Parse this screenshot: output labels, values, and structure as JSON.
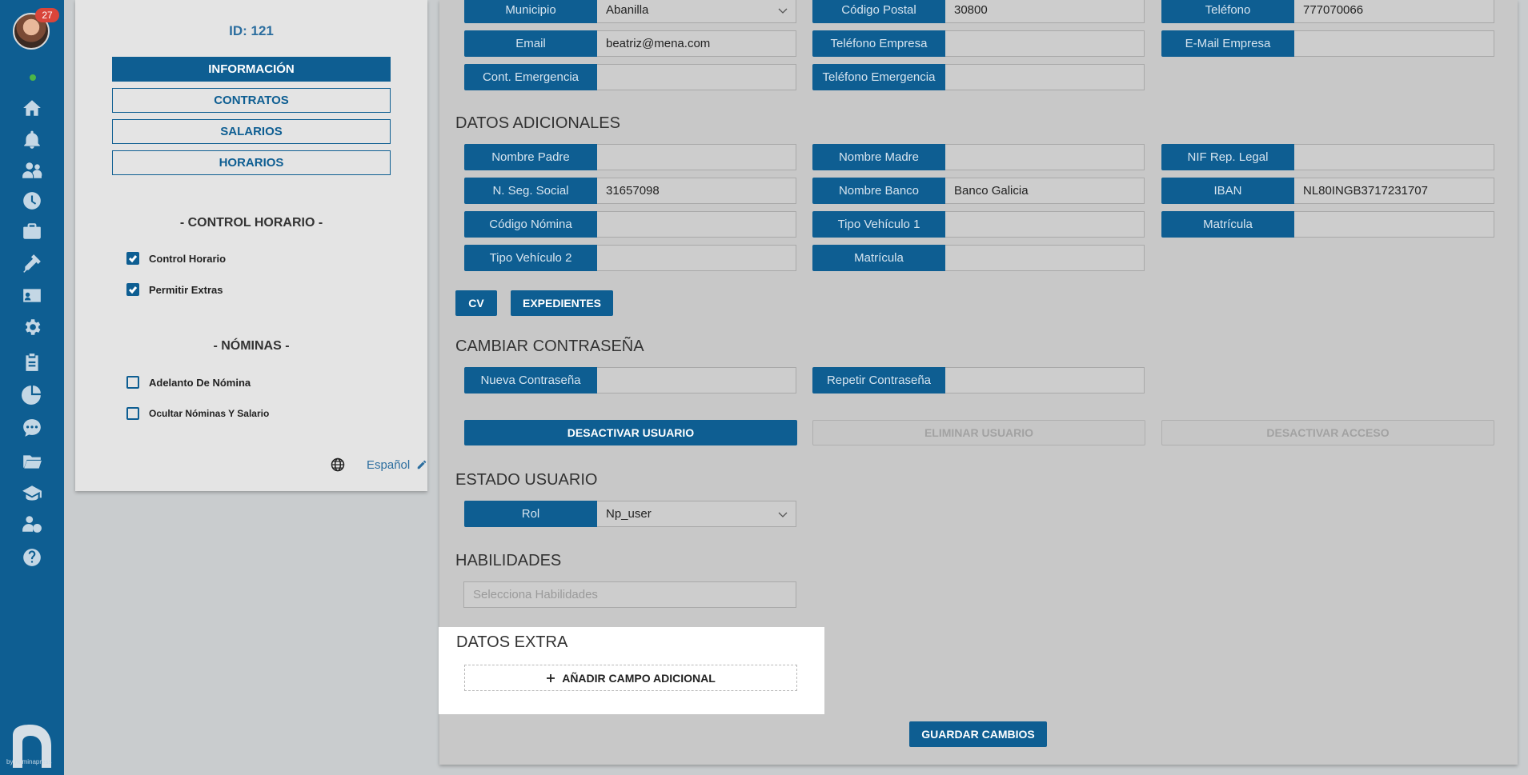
{
  "sidebar": {
    "badge": "27",
    "icons": [
      "home-icon",
      "bell-icon",
      "users-icon",
      "clock-icon",
      "briefcase-icon",
      "tools-icon",
      "id-card-icon",
      "gear-icon",
      "clipboard-icon",
      "pie-chart-icon",
      "chat-icon",
      "folder-icon",
      "graduation-cap-icon",
      "user-money-icon",
      "help-icon"
    ],
    "logo_by": "by nominapress"
  },
  "profile": {
    "id_label": "ID: 121",
    "nav": [
      "INFORMACIÓN",
      "CONTRATOS",
      "SALARIOS",
      "HORARIOS"
    ],
    "control_horario_title": "- CONTROL HORARIO -",
    "control_horario": [
      {
        "label": "Control Horario",
        "checked": true
      },
      {
        "label": "Permitir Extras",
        "checked": true
      }
    ],
    "nominas_title": "- NÓMINAS -",
    "nominas": [
      {
        "label": "Adelanto De Nómina",
        "checked": false
      },
      {
        "label": "Ocultar Nóminas Y Salario",
        "checked": false
      }
    ],
    "language": "Español"
  },
  "contact": {
    "municipio": {
      "label": "Municipio",
      "value": "Abanilla"
    },
    "codigo_postal": {
      "label": "Código Postal",
      "value": "30800"
    },
    "telefono": {
      "label": "Teléfono",
      "value": "777070066"
    },
    "email": {
      "label": "Email",
      "value": "beatriz@mena.com"
    },
    "telefono_empresa": {
      "label": "Teléfono Empresa",
      "value": ""
    },
    "email_empresa": {
      "label": "E-Mail Empresa",
      "value": ""
    },
    "cont_emergencia": {
      "label": "Cont. Emergencia",
      "value": ""
    },
    "telefono_emergencia": {
      "label": "Teléfono Emergencia",
      "value": ""
    }
  },
  "datos_adicionales": {
    "title": "DATOS ADICIONALES",
    "nombre_padre": {
      "label": "Nombre Padre",
      "value": ""
    },
    "nombre_madre": {
      "label": "Nombre Madre",
      "value": ""
    },
    "nif_rep_legal": {
      "label": "NIF Rep. Legal",
      "value": ""
    },
    "n_seg_social": {
      "label": "N. Seg. Social",
      "value": "31657098"
    },
    "nombre_banco": {
      "label": "Nombre Banco",
      "value": "Banco Galicia"
    },
    "iban": {
      "label": "IBAN",
      "value": "NL80INGB3717231707"
    },
    "codigo_nomina": {
      "label": "Código Nómina",
      "value": ""
    },
    "tipo_vehiculo_1": {
      "label": "Tipo Vehículo 1",
      "value": ""
    },
    "matricula_1": {
      "label": "Matrícula",
      "value": ""
    },
    "tipo_vehiculo_2": {
      "label": "Tipo Vehículo 2",
      "value": ""
    },
    "matricula_2": {
      "label": "Matrícula",
      "value": ""
    },
    "cv_button": "CV",
    "expedientes_button": "EXPEDIENTES"
  },
  "password": {
    "title": "CAMBIAR CONTRASEÑA",
    "nueva": {
      "label": "Nueva Contraseña",
      "value": ""
    },
    "repetir": {
      "label": "Repetir Contraseña",
      "value": ""
    }
  },
  "actions": {
    "desactivar_usuario": "DESACTIVAR USUARIO",
    "eliminar_usuario": "ELIMINAR USUARIO",
    "desactivar_acceso": "DESACTIVAR ACCESO"
  },
  "estado": {
    "title": "ESTADO USUARIO",
    "rol": {
      "label": "Rol",
      "value": "Np_user"
    }
  },
  "habilidades": {
    "title": "HABILIDADES",
    "placeholder": "Selecciona Habilidades"
  },
  "datos_extra": {
    "title": "DATOS EXTRA",
    "add_button": "AÑADIR CAMPO ADICIONAL"
  },
  "save_button": "GUARDAR CAMBIOS",
  "colors": {
    "primary": "#0e5e92",
    "accent_text": "#2c6e9f",
    "badge": "#d9453a",
    "online": "#4cb648"
  }
}
